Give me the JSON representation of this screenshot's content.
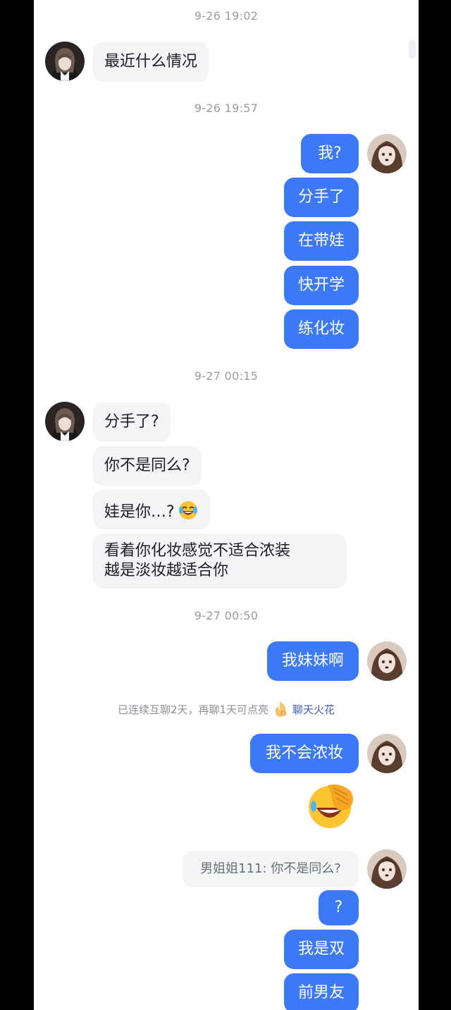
{
  "timestamps": {
    "t1": "9-26 19:02",
    "t2": "9-26 19:57",
    "t3": "9-27 00:15",
    "t4": "9-27 00:50"
  },
  "messages": {
    "m1": "最近什么情况",
    "m2": "我?",
    "m3": "分手了",
    "m4": "在带娃",
    "m5": "快开学",
    "m6": "练化妆",
    "m7": "分手了?",
    "m8": "你不是同么?",
    "m9": "娃是你…?",
    "m10_line1": "看着你化妆感觉不适合浓装",
    "m10_line2": "越是淡妆越适合你",
    "m11": "我妹妹啊",
    "m12": "我不会浓妆",
    "m13_quote": "男姐姐111: 你不是同么?",
    "m14": "?",
    "m15": "我是双",
    "m16": "前男友"
  },
  "notice": {
    "text": "已连续互聊2天，再聊1天可点亮",
    "link": "聊天火花"
  },
  "icons": {
    "laughing_emoji": "face-with-tears-of-joy",
    "facepalm_emoji": "face-palm-laughing",
    "spark_flame": "flame-icon"
  },
  "colors": {
    "outgoing_bubble": "#3b79f6",
    "incoming_bubble": "#f3f4f6",
    "timestamp_text": "#9a9ca3"
  }
}
